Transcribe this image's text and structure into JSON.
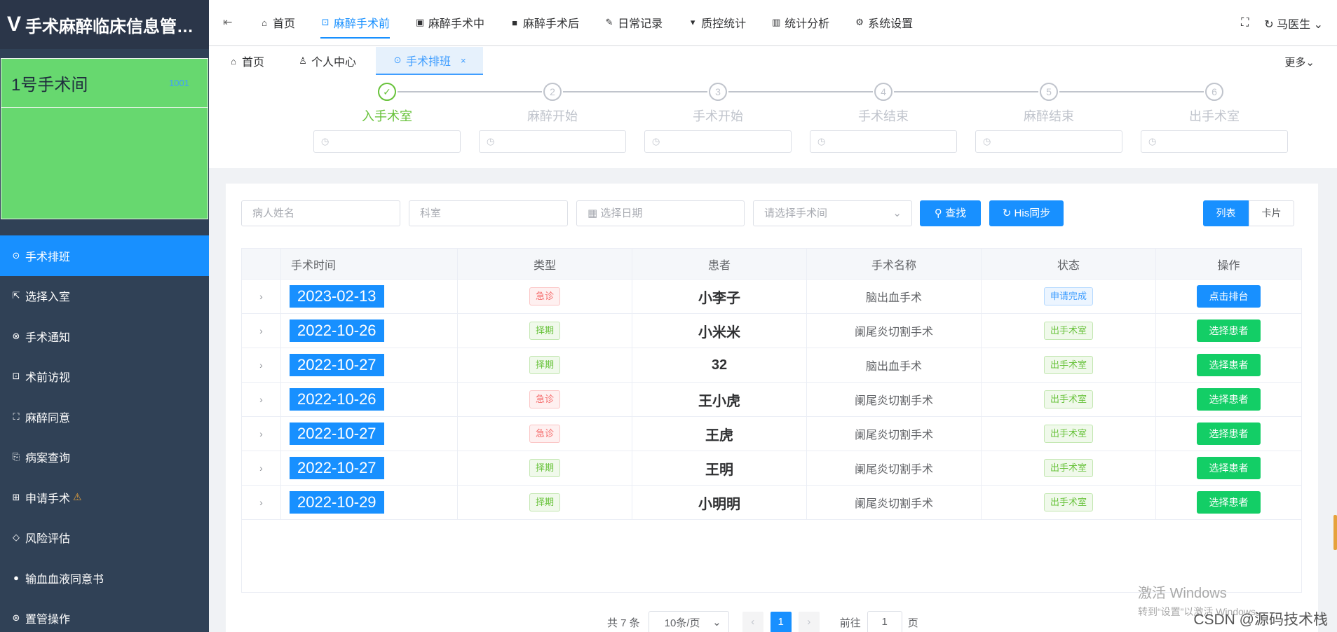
{
  "app": {
    "logo_glyph": "V",
    "title": "手术麻醉临床信息管…"
  },
  "room": {
    "name": "1号手术间",
    "number": "1001"
  },
  "sidebar": {
    "items": [
      {
        "icon": "⊙",
        "icon_name": "compass-icon",
        "label": "手术排班",
        "active": true
      },
      {
        "icon": "⇱",
        "icon_name": "enter-icon",
        "label": "选择入室"
      },
      {
        "icon": "⊗",
        "icon_name": "notice-icon",
        "label": "手术通知"
      },
      {
        "icon": "⊡",
        "icon_name": "visit-icon",
        "label": "术前访视"
      },
      {
        "icon": "⛶",
        "icon_name": "consent-icon",
        "label": "麻醉同意"
      },
      {
        "icon": "⎘",
        "icon_name": "record-icon",
        "label": "病案查询"
      },
      {
        "icon": "⊞",
        "icon_name": "apply-icon",
        "label": "申请手术",
        "warn": "⚠"
      },
      {
        "icon": "◇",
        "icon_name": "risk-icon",
        "label": "风险评估"
      },
      {
        "icon": "●",
        "icon_name": "blood-drop-icon",
        "label": "输血血液同意书"
      },
      {
        "icon": "⊛",
        "icon_name": "tube-icon",
        "label": "置管操作"
      }
    ]
  },
  "topnav": {
    "fold_icon": "⇤",
    "items": [
      {
        "icon": "⌂",
        "icon_name": "home-icon",
        "label": "首页"
      },
      {
        "icon": "⊡",
        "icon_name": "pre-op-icon",
        "label": "麻醉手术前",
        "active": true
      },
      {
        "icon": "▣",
        "icon_name": "intra-op-icon",
        "label": "麻醉手术中"
      },
      {
        "icon": "■",
        "icon_name": "camera-icon",
        "label": "麻醉手术后"
      },
      {
        "icon": "✎",
        "icon_name": "pen-icon",
        "label": "日常记录"
      },
      {
        "icon": "▾",
        "icon_name": "bookmark-icon",
        "label": "质控统计"
      },
      {
        "icon": "▥",
        "icon_name": "bar-chart-icon",
        "label": "统计分析"
      },
      {
        "icon": "⚙",
        "icon_name": "gear-icon",
        "label": "系统设置"
      }
    ],
    "fullscreen_icon": "⛶",
    "refresh_icon": "↻",
    "user": "马医生",
    "user_caret": "⌄"
  },
  "tags": {
    "items": [
      {
        "icon": "⌂",
        "icon_name": "home-icon",
        "label": "首页"
      },
      {
        "icon": "♙",
        "icon_name": "user-icon",
        "label": "个人中心"
      },
      {
        "icon": "⊙",
        "icon_name": "compass-icon",
        "label": "手术排班",
        "active": true,
        "close": "×"
      }
    ],
    "more": "更多⌄"
  },
  "steps": [
    {
      "mark": "✓",
      "label": "入手术室",
      "done": true
    },
    {
      "mark": "2",
      "label": "麻醉开始"
    },
    {
      "mark": "3",
      "label": "手术开始"
    },
    {
      "mark": "4",
      "label": "手术结束"
    },
    {
      "mark": "5",
      "label": "麻醉结束"
    },
    {
      "mark": "6",
      "label": "出手术室"
    }
  ],
  "step_input_icon": "◷",
  "filters": {
    "patient_placeholder": "病人姓名",
    "dept_placeholder": "科室",
    "date_placeholder": "选择日期",
    "date_icon": "▦",
    "room_placeholder": "请选择手术间",
    "room_caret": "⌄",
    "search_icon": "⚲",
    "search_label": "查找",
    "sync_icon": "↻",
    "sync_label": "His同步",
    "view_list": "列表",
    "view_card": "卡片"
  },
  "table": {
    "headers": [
      "手术时间",
      "类型",
      "患者",
      "手术名称",
      "状态",
      "操作"
    ],
    "expand_icon": "›",
    "rows": [
      {
        "date": "2023-02-13",
        "type": "急诊",
        "type_color": "red",
        "patient": "小李子",
        "surgery": "脑出血手术",
        "status": "申请完成",
        "status_color": "blue",
        "action": "点击排台",
        "action_color": "blue"
      },
      {
        "date": "2022-10-26",
        "type": "择期",
        "type_color": "green",
        "patient": "小米米",
        "surgery": "阑尾炎切割手术",
        "status": "出手术室",
        "status_color": "green",
        "action": "选择患者",
        "action_color": "green"
      },
      {
        "date": "2022-10-27",
        "type": "择期",
        "type_color": "green",
        "patient": "32",
        "surgery": "脑出血手术",
        "status": "出手术室",
        "status_color": "green",
        "action": "选择患者",
        "action_color": "green"
      },
      {
        "date": "2022-10-26",
        "type": "急诊",
        "type_color": "red",
        "patient": "王小虎",
        "surgery": "阑尾炎切割手术",
        "status": "出手术室",
        "status_color": "green",
        "action": "选择患者",
        "action_color": "green"
      },
      {
        "date": "2022-10-27",
        "type": "急诊",
        "type_color": "red",
        "patient": "王虎",
        "surgery": "阑尾炎切割手术",
        "status": "出手术室",
        "status_color": "green",
        "action": "选择患者",
        "action_color": "green"
      },
      {
        "date": "2022-10-27",
        "type": "择期",
        "type_color": "green",
        "patient": "王明",
        "surgery": "阑尾炎切割手术",
        "status": "出手术室",
        "status_color": "green",
        "action": "选择患者",
        "action_color": "green"
      },
      {
        "date": "2022-10-29",
        "type": "择期",
        "type_color": "green",
        "patient": "小明明",
        "surgery": "阑尾炎切割手术",
        "status": "出手术室",
        "status_color": "green",
        "action": "选择患者",
        "action_color": "green"
      }
    ]
  },
  "pager": {
    "total": "共 7 条",
    "page_size": "10条/页",
    "size_caret": "⌄",
    "prev": "‹",
    "current": "1",
    "next": "›",
    "goto": "前往",
    "goto_value": "1",
    "page_unit": "页"
  },
  "watermark": {
    "line1": "激活 Windows",
    "line2": "转到“设置”以激活 Windows。"
  },
  "csdn": "CSDN @源码技术栈"
}
